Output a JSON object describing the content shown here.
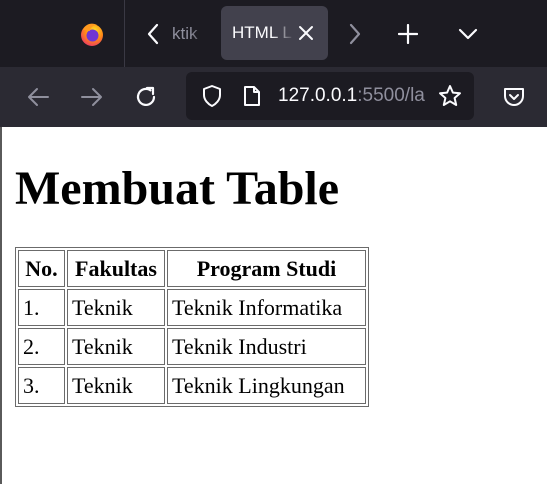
{
  "browser": {
    "tabs": {
      "previous_tab_fragment": "ktik",
      "active_tab_title": "HTML L",
      "icons": {
        "app": "firefox-icon",
        "scroll_left": "chevron-left-icon",
        "close": "close-icon",
        "scroll_right": "chevron-right-icon",
        "new_tab": "plus-icon",
        "list_all": "chevron-down-icon"
      }
    },
    "toolbar": {
      "url_host": "127.0.0.1",
      "url_rest": ":5500/la",
      "icons": {
        "back": "arrow-left-icon",
        "forward": "arrow-right-icon",
        "reload": "reload-icon",
        "site_info": "shield-icon",
        "page": "page-icon",
        "bookmark": "star-icon",
        "pocket": "pocket-icon"
      }
    },
    "colors": {
      "tabstrip_bg": "#1c1b22",
      "toolbar_bg": "#2b2a33",
      "active_tab_bg": "#42414d",
      "urlbar_bg": "#1c1b22",
      "icon_color": "#fbfbfe"
    }
  },
  "page": {
    "title": "Membuat Table",
    "table": {
      "headers": [
        "No.",
        "Fakultas",
        "Program Studi"
      ],
      "rows": [
        [
          "1.",
          "Teknik",
          "Teknik Informatika"
        ],
        [
          "2.",
          "Teknik",
          "Teknik Industri"
        ],
        [
          "3.",
          "Teknik",
          "Teknik Lingkungan"
        ]
      ]
    }
  }
}
